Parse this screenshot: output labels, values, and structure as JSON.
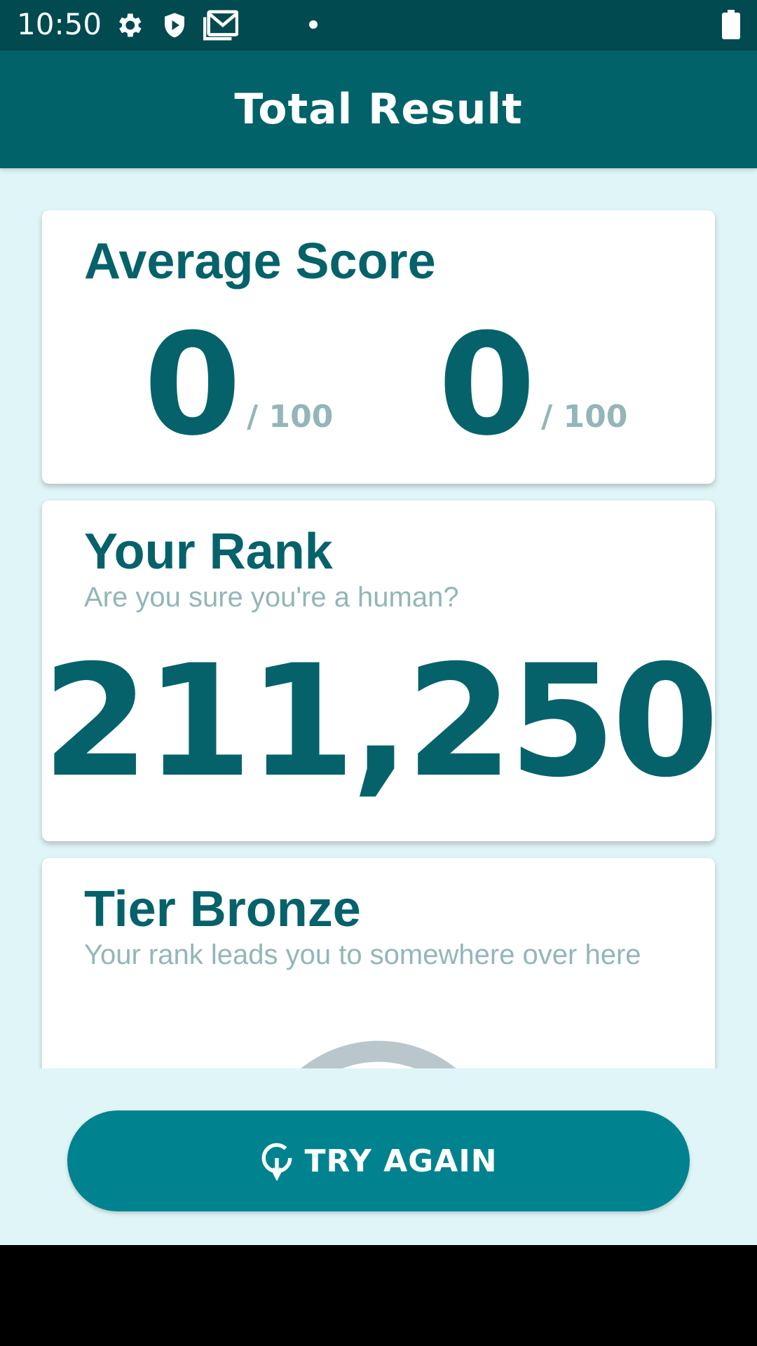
{
  "status_bar": {
    "time": "10:50",
    "icons": [
      "settings-icon",
      "shield-play-icon",
      "gmail-icon",
      "notification-dot-icon",
      "battery-icon"
    ]
  },
  "app_bar": {
    "title": "Total Result"
  },
  "average_score": {
    "title": "Average Score",
    "scores": [
      {
        "value": "0",
        "max": "/ 100"
      },
      {
        "value": "0",
        "max": "/ 100"
      }
    ]
  },
  "rank": {
    "title": "Your Rank",
    "subtitle": "Are you sure you're a human?",
    "value": "211,250"
  },
  "tier": {
    "title": "Tier Bronze",
    "subtitle": "Your rank leads you to somewhere over here"
  },
  "actions": {
    "try_again_label": "TRY AGAIN",
    "icon": "refresh-icon"
  },
  "colors": {
    "primary_dark": "#004a50",
    "primary": "#02626a",
    "accent": "#00838f",
    "text_primary": "#05626a",
    "text_muted": "#93b6b8",
    "background": "#e0f5f7"
  }
}
